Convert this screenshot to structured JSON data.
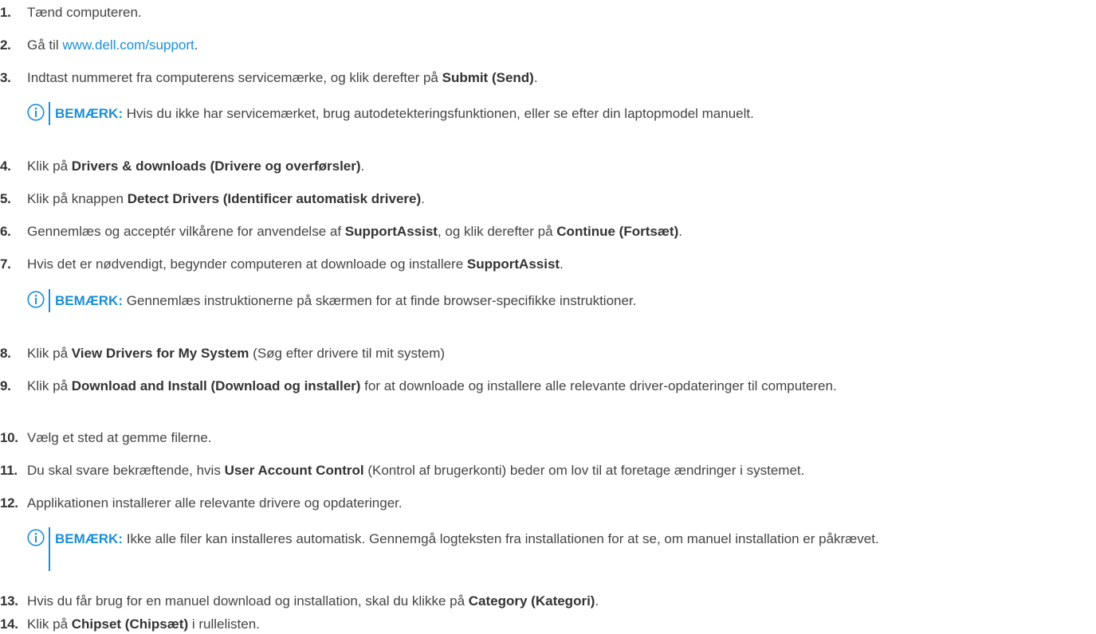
{
  "link_color": "#1a8fd6",
  "note_icon": "info-icon",
  "steps": [
    {
      "num": "1.",
      "t1": "Tænd computeren."
    },
    {
      "num": "2.",
      "t1": "Gå til ",
      "link": "www.dell.com/support",
      "t2": "."
    },
    {
      "num": "3.",
      "t1": "Indtast nummeret fra computerens servicemærke, og klik derefter på ",
      "b1": "Submit (Send)",
      "t2": "."
    },
    {
      "num": "4.",
      "t1": "Klik på ",
      "b1": "Drivers & downloads (Drivere og overførsler)",
      "t2": "."
    },
    {
      "num": "5.",
      "t1": "Klik på knappen ",
      "b1": "Detect Drivers (Identificer automatisk drivere)",
      "t2": "."
    },
    {
      "num": "6.",
      "t1": "Gennemlæs og acceptér vilkårene for anvendelse af ",
      "b1": "SupportAssist",
      "t2": ", og klik derefter på ",
      "b2": "Continue (Fortsæt)",
      "t3": "."
    },
    {
      "num": "7.",
      "t1": "Hvis det er nødvendigt, begynder computeren at downloade og installere ",
      "b1": "SupportAssist",
      "t2": "."
    },
    {
      "num": "8.",
      "t1": "Klik på ",
      "b1": "View Drivers for My System",
      "t2": " (Søg efter drivere til mit system)"
    },
    {
      "num": "9.",
      "t1": "Klik på ",
      "b1": "Download and Install (Download og installer)",
      "t2": " for at downloade og installere alle relevante driver-opdateringer til computeren."
    },
    {
      "num": "10.",
      "t1": "Vælg et sted at gemme filerne."
    },
    {
      "num": "11.",
      "t1": "Du skal svare bekræftende, hvis ",
      "b1": "User Account Control",
      "t2": " (Kontrol af brugerkonti) beder om lov til at foretage ændringer i systemet."
    },
    {
      "num": "12.",
      "t1": "Applikationen installerer alle relevante drivere og opdateringer."
    },
    {
      "num": "13.",
      "t1": "Hvis du får brug for en manuel download og installation, skal du klikke på ",
      "b1": "Category (Kategori)",
      "t2": "."
    },
    {
      "num": "14.",
      "t1": "Klik på ",
      "b1": "Chipset (Chipsæt)",
      "t2": " i rullelisten."
    }
  ],
  "notes": [
    {
      "label": "BEMÆRK:",
      "text": " Hvis du ikke har servicemærket, brug autodetekteringsfunktionen, eller se efter din laptopmodel manuelt."
    },
    {
      "label": "BEMÆRK:",
      "text": " Gennemlæs instruktionerne på skærmen for at finde browser-specifikke instruktioner."
    },
    {
      "label": "BEMÆRK:",
      "text": " Ikke alle filer kan installeres automatisk. Gennemgå logteksten fra installationen for at se, om manuel installation er påkrævet."
    }
  ]
}
